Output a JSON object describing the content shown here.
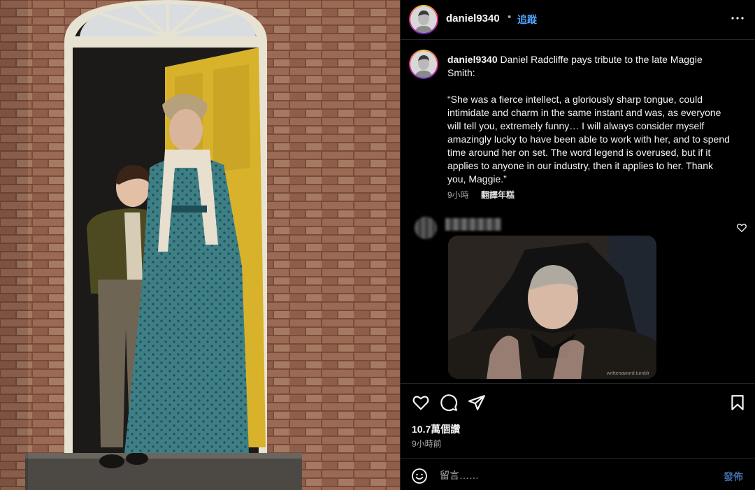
{
  "post": {
    "username": "daniel9340",
    "dot": "•",
    "follow_label": "追蹤",
    "more_icon": "more-horizontal-icon"
  },
  "caption": {
    "username": "daniel9340",
    "text": " Daniel Radcliffe pays tribute to the late Maggie Smith:\n\n“She was a fierce intellect, a gloriously sharp tongue, could intimidate and charm in the same instant and was, as everyone will tell you, extremely funny… I will always consider myself amazingly lucky to have been able to work with her, and to spend time around her on set. The word legend is overused, but if it applies to anyone in our industry, then it applies to her. Thank you, Maggie.”",
    "time": "9小時",
    "translate_label": "翻譯年糕"
  },
  "comment": {
    "gif_watermark": "writtenaword.tumblr"
  },
  "actions": {
    "like_icon": "heart-icon",
    "comment_icon": "comment-icon",
    "share_icon": "send-icon",
    "save_icon": "bookmark-icon",
    "likes_text": "10.7萬個讚",
    "time_ago": "9小時前"
  },
  "composer": {
    "placeholder": "留言……",
    "post_label": "發佈",
    "emoji_icon": "smiley-icon"
  },
  "colors": {
    "background": "#000000",
    "link_blue": "#4fa5ff",
    "post_button": "#3d6aa8",
    "secondary_text": "#a8a8a8"
  }
}
